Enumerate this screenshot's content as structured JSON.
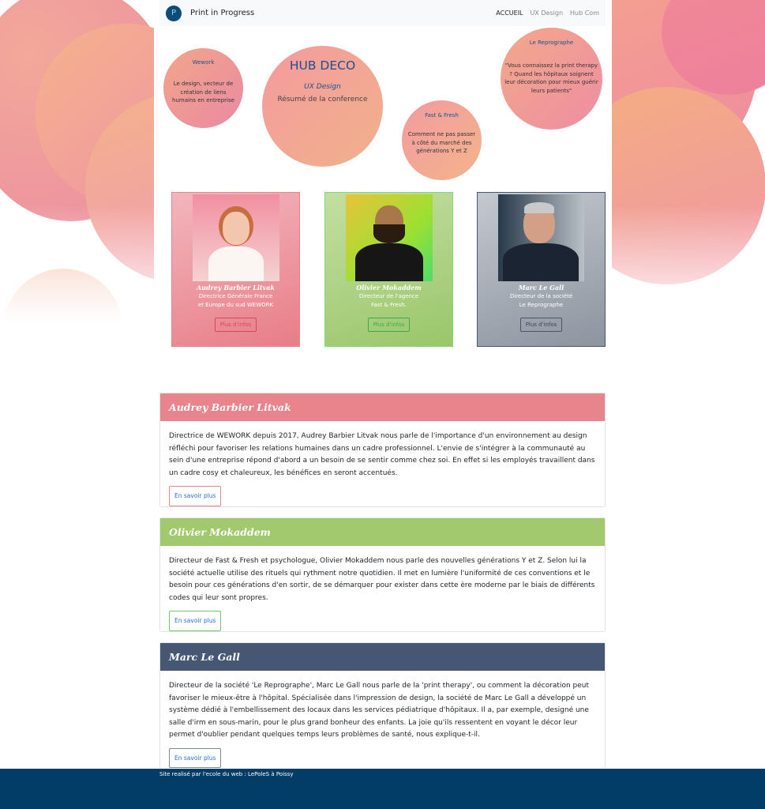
{
  "colors": {
    "pink": "#e8848c",
    "green": "#a2c96d",
    "slate": "#455772",
    "footer": "#023d67",
    "accent_blue": "#1f4f8f"
  },
  "navbar": {
    "logo_icon": "logo-icon",
    "brand": "Print in Progress",
    "links": [
      "ACCUEIL",
      "UX Design",
      "Hub Com"
    ]
  },
  "circles": {
    "wework": {
      "title": "Wework",
      "text": "Le design, vecteur de création de liens humains en entreprise"
    },
    "hub": {
      "title": "HUB DECO",
      "subtitle": "UX Design",
      "text": "Résumé de la conference"
    },
    "fast": {
      "title": "Fast & Fresh",
      "text": "Comment ne pas passer à côté du marché des générations Y et Z"
    },
    "repro": {
      "title": "Le Reprographe",
      "text": "\"Vous connaissez la print therapy ? Quand les hôpitaux soignent leur décoration pour mieux guérir leurs patients\""
    }
  },
  "cards": [
    {
      "name": "Audrey Barbier Litvak",
      "role_line1": "Directrice Générale France",
      "role_line2": "et Europe du sud WEWORK",
      "button": "Plus d'infos"
    },
    {
      "name": "Olivier Mokaddem",
      "role_line1": "Directeur de l'agence",
      "role_line2": "Fast & Fresh.",
      "button": "Plus d'infos"
    },
    {
      "name": "Marc Le Gall",
      "role_line1": "Directeur de la société",
      "role_line2": "Le Reprographe",
      "button": "Plus d'infos"
    }
  ],
  "panels": [
    {
      "title": "Audrey Barbier Litvak",
      "body": "Directrice de WEWORK depuis 2017, Audrey Barbier Litvak nous parle de l'importance d'un environnement au design réfléchi pour favoriser les relations humaines dans un cadre professionnel. L'envie de s'intégrer à la communauté au sein d'une entreprise répond d'abord a un besoin de se sentir comme chez soi. En effet si les employés travaillent dans un cadre cosy et chaleureux, les bénéfices en seront accentués.",
      "button": "En savoir plus"
    },
    {
      "title": "Olivier Mokaddem",
      "body": "Directeur de Fast & Fresh et psychologue, Olivier Mokaddem nous parle des nouvelles générations Y et Z. Selon lui la société actuelle utilise des rituels qui rythment notre quotidien. Il met en lumière l'uniformité de ces conventions et le besoin pour ces générations d'en sortir, de se démarquer pour exister dans cette ère moderne par le biais de différents codes qui leur sont propres.",
      "button": "En savoir plus"
    },
    {
      "title": "Marc Le Gall",
      "body": "Directeur de la société 'Le Reprographe', Marc Le Gall nous parle de la 'print therapy', ou comment la décoration peut favoriser le mieux-être à l'hôpital. Spécialisée dans l'impression de design, la société de Marc Le Gall a développé un système dédié à l'embellissement des locaux dans les services pédiatrique d'hôpitaux. Il a, par exemple, designé une salle d'irm en sous-marin, pour le plus grand bonheur des enfants. La joie qu'ils ressentent en voyant le décor leur permet d'oublier pendant quelques temps leurs problèmes de santé, nous explique-t-il.",
      "button": "En savoir plus"
    }
  ],
  "footer": {
    "text": "Site realisé par l'ecole du web : LePoleS à Poissy"
  }
}
